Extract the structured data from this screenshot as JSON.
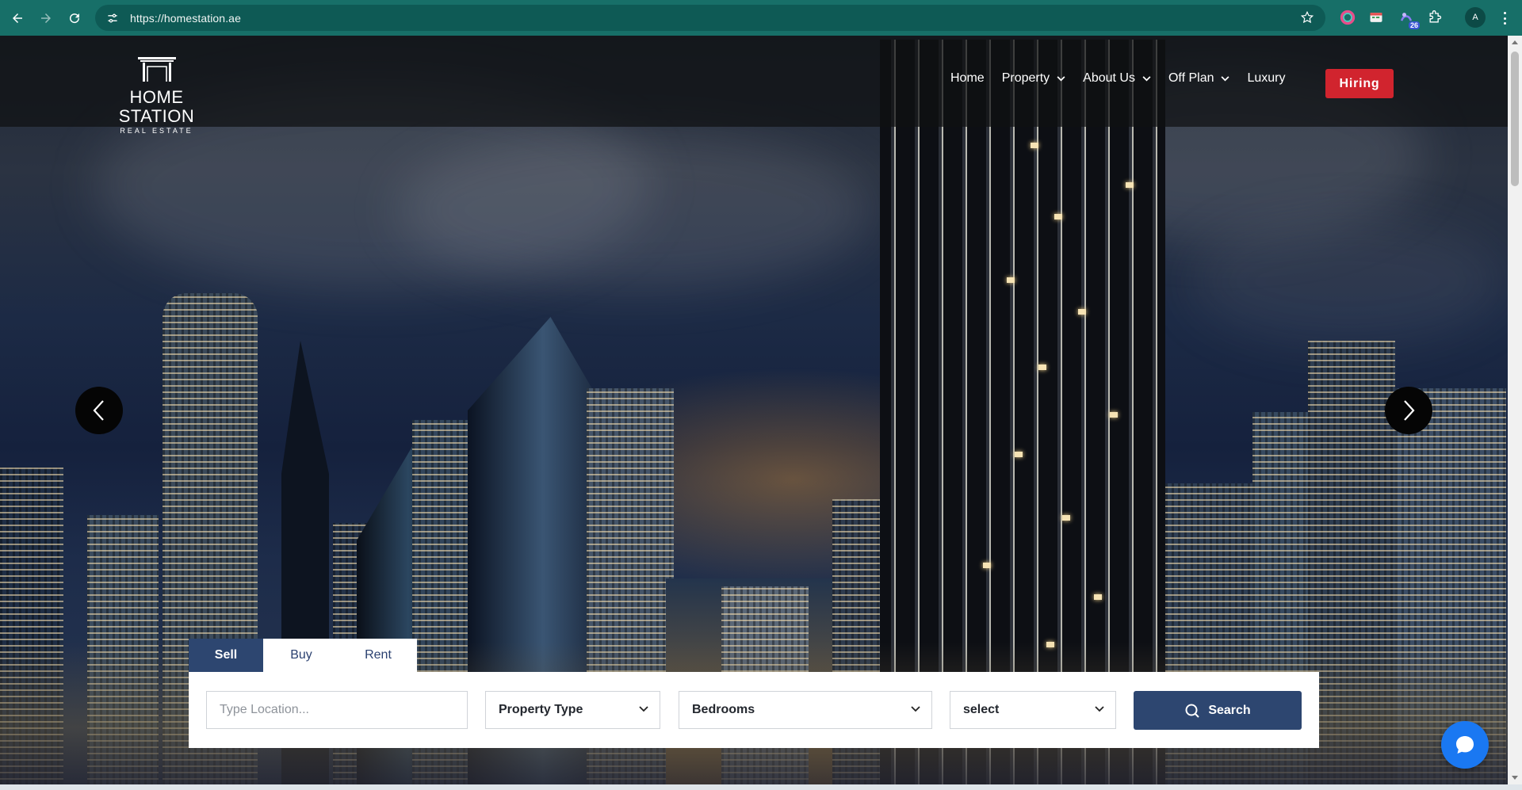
{
  "browser": {
    "url": "https://homestation.ae",
    "extension_badge": "26",
    "profile_initial": "A"
  },
  "brand": {
    "name": "HOME STATION",
    "tagline": "REAL ESTATE"
  },
  "nav": {
    "home": "Home",
    "property": "Property",
    "about": "About Us",
    "offplan": "Off Plan",
    "luxury": "Luxury",
    "hiring": "Hiring"
  },
  "search": {
    "tabs": [
      "Sell",
      "Buy",
      "Rent"
    ],
    "active_tab": "Sell",
    "location_placeholder": "Type Location...",
    "property_type": "Property Type",
    "bedrooms": "Bedrooms",
    "extra_select": "select",
    "button": "Search"
  },
  "colors": {
    "chrome": "#176f68",
    "navy": "#2d4670",
    "hiring_red": "#d1242e",
    "chat_blue": "#1a78f2"
  },
  "icons": {
    "back": "arrow-left-icon",
    "forward": "arrow-right-icon",
    "reload": "reload-icon",
    "site_info": "tune-icon",
    "bookmark": "star-icon",
    "carousel_prev": "chevron-left-icon",
    "carousel_next": "chevron-right-icon",
    "search": "search-icon",
    "chat": "chat-icon"
  }
}
